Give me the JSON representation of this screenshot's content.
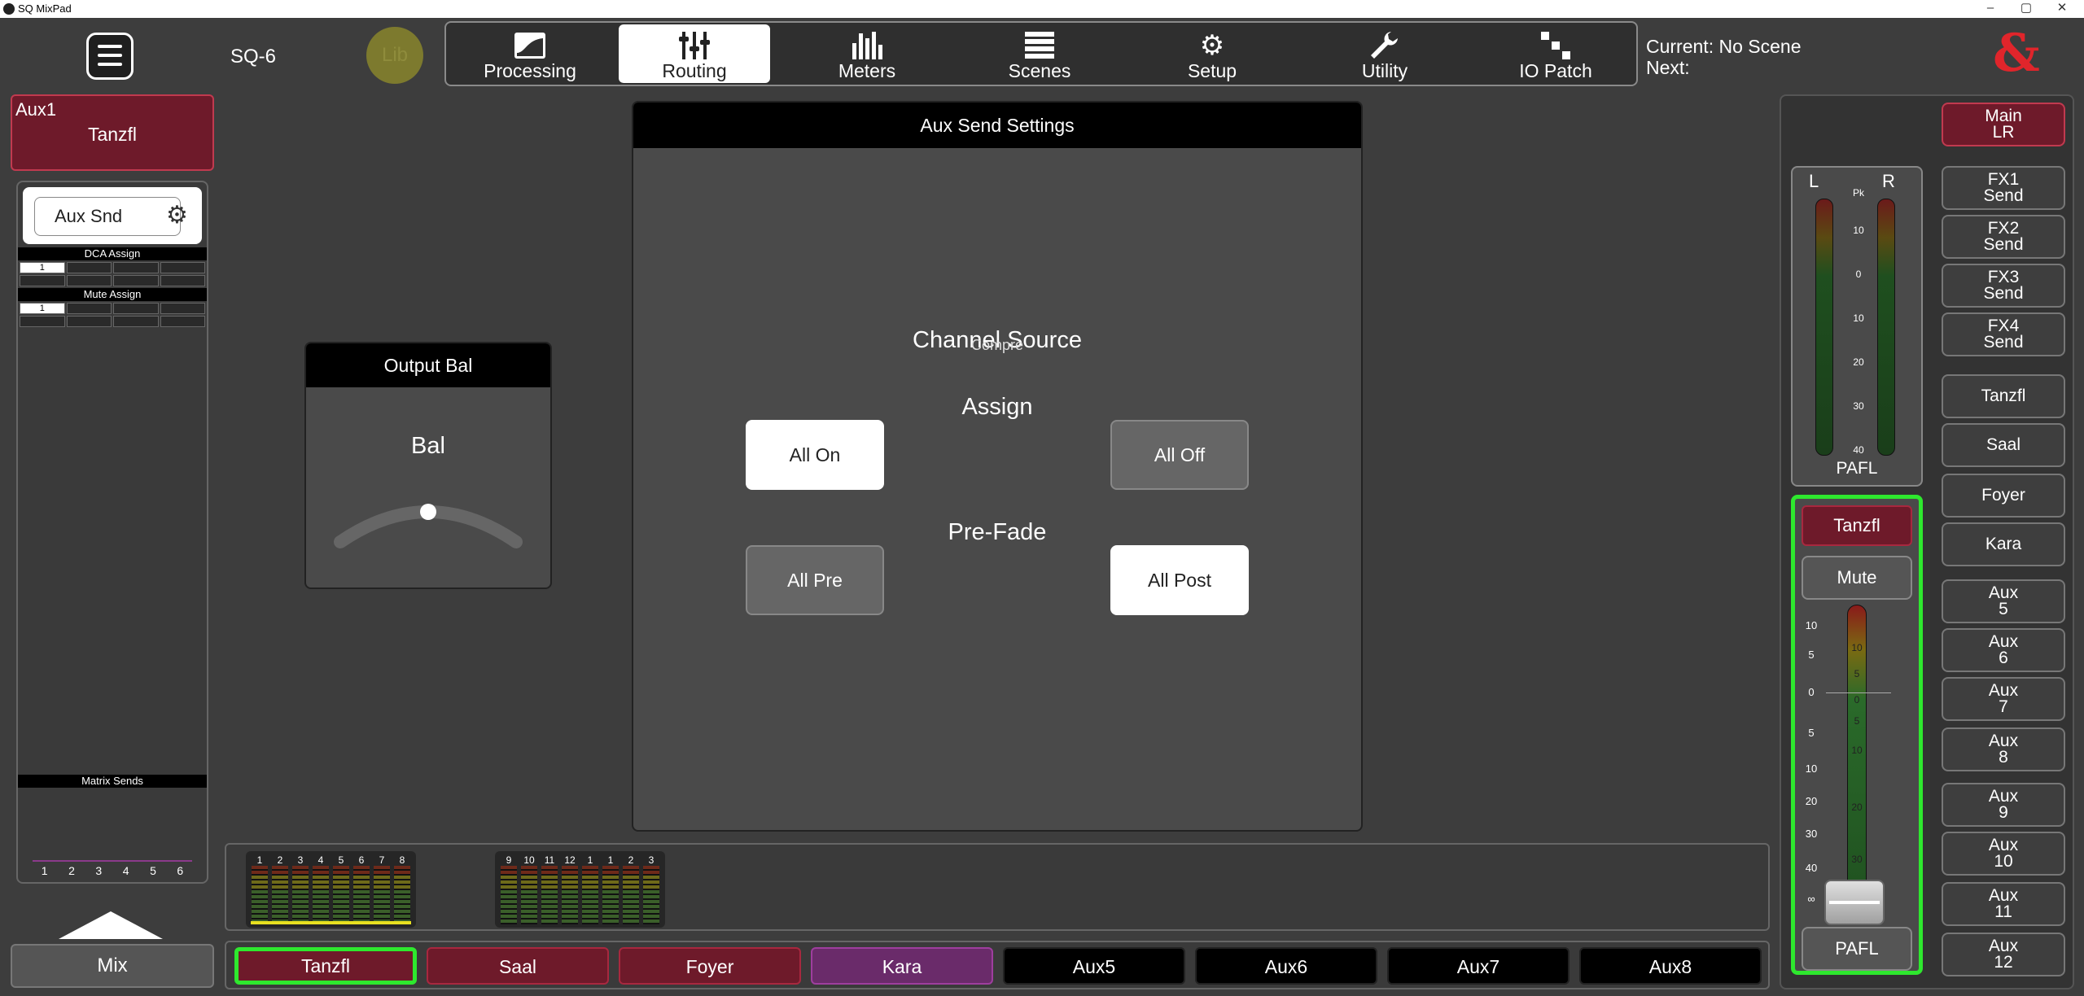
{
  "window": {
    "title": "SQ MixPad",
    "controls": [
      "–",
      "▢",
      "✕"
    ]
  },
  "header": {
    "console": "SQ-6",
    "lib": "Lib",
    "tabs": [
      {
        "label": "Processing",
        "icon": "processing-icon"
      },
      {
        "label": "Routing",
        "icon": "routing-icon",
        "active": true
      },
      {
        "label": "Meters",
        "icon": "meters-icon"
      },
      {
        "label": "Scenes",
        "icon": "scenes-icon"
      },
      {
        "label": "Setup",
        "icon": "setup-gear-icon"
      },
      {
        "label": "Utility",
        "icon": "utility-wrench-icon"
      },
      {
        "label": "IO Patch",
        "icon": "io-patch-icon"
      }
    ],
    "current_scene": "Current: No Scene",
    "next_scene": "Next:",
    "logo": "&"
  },
  "left_strip": {
    "aux_number": "Aux1",
    "aux_name": "Tanzfl",
    "aux_snd": "Aux Snd",
    "dca_assign": "DCA Assign",
    "dca_first": "1",
    "mute_assign": "Mute Assign",
    "mute_first": "1",
    "matrix_sends": "Matrix Sends",
    "matrix_numbers": [
      "1",
      "2",
      "3",
      "4",
      "5",
      "6"
    ],
    "mix_label": "Mix"
  },
  "output_bal": {
    "title": "Output Bal",
    "label": "Bal",
    "value": 0
  },
  "aux_send_settings": {
    "title": "Aux Send Settings",
    "channel_source": "Channel Source",
    "overlay": "Compre",
    "assign_label": "Assign",
    "all_on": "All On",
    "all_off": "All Off",
    "prefade_label": "Pre-Fade",
    "all_pre": "All Pre",
    "all_post": "All Post"
  },
  "meters": {
    "group1": [
      "1",
      "2",
      "3",
      "4",
      "5",
      "6",
      "7",
      "8"
    ],
    "group2": [
      "9",
      "10",
      "11",
      "12",
      "1",
      "1",
      "2",
      "3"
    ]
  },
  "channel_tabs": [
    {
      "label": "Tanzfl",
      "style": "red",
      "selected": true
    },
    {
      "label": "Saal",
      "style": "red"
    },
    {
      "label": "Foyer",
      "style": "red"
    },
    {
      "label": "Kara",
      "style": "purple"
    },
    {
      "label": "Aux5",
      "style": "black"
    },
    {
      "label": "Aux6",
      "style": "black"
    },
    {
      "label": "Aux7",
      "style": "black"
    },
    {
      "label": "Aux8",
      "style": "black"
    }
  ],
  "pafl_meter": {
    "left": "L",
    "right": "R",
    "pk": "Pk",
    "scale": [
      "10",
      "0",
      "10",
      "20",
      "30",
      "40"
    ],
    "label": "PAFL"
  },
  "master_strip": {
    "name": "Tanzfl",
    "mute": "Mute",
    "pafl": "PAFL",
    "scale": [
      "10",
      "5",
      "0",
      "5",
      "10",
      "20",
      "30",
      "40",
      "∞"
    ],
    "inner_scale": [
      "10",
      "5",
      "0",
      "5",
      "10",
      "20",
      "30"
    ]
  },
  "right_buttons": [
    {
      "label": "Main\nLR",
      "style": "red"
    },
    {
      "label": "FX1\nSend"
    },
    {
      "label": "FX2\nSend"
    },
    {
      "label": "FX3\nSend"
    },
    {
      "label": "FX4\nSend"
    },
    {
      "label": "Tanzfl"
    },
    {
      "label": "Saal"
    },
    {
      "label": "Foyer"
    },
    {
      "label": "Kara"
    },
    {
      "label": "Aux\n5"
    },
    {
      "label": "Aux\n6"
    },
    {
      "label": "Aux\n7"
    },
    {
      "label": "Aux\n8"
    },
    {
      "label": "Aux\n9"
    },
    {
      "label": "Aux\n10"
    },
    {
      "label": "Aux\n11"
    },
    {
      "label": "Aux\n12"
    }
  ],
  "colors": {
    "accent_red": "#6e1a2a",
    "select_green": "#2ee82e",
    "kara_purple": "#6a2b6a"
  }
}
